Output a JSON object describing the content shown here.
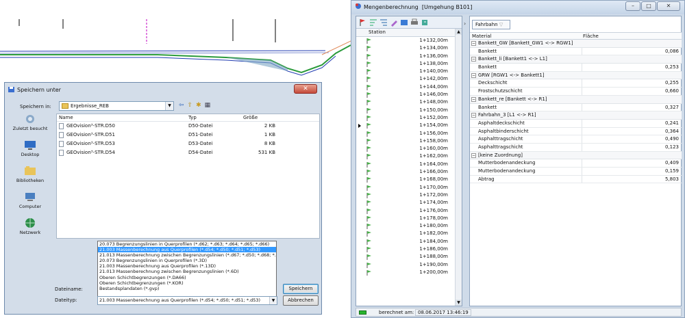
{
  "cad": {},
  "mengen_window": {
    "title": "Mengenberechnung",
    "subtitle": "[Umgehung B101]",
    "buttons": {
      "minimize": "–",
      "maximize": "□",
      "close": "✕"
    },
    "station_header": "Station",
    "stations": [
      "1+132,00m",
      "1+134,00m",
      "1+136,00m",
      "1+138,00m",
      "1+140,00m",
      "1+142,00m",
      "1+144,00m",
      "1+146,00m",
      "1+148,00m",
      "1+150,00m",
      "1+152,00m",
      "1+154,00m",
      "1+156,00m",
      "1+158,00m",
      "1+160,00m",
      "1+162,00m",
      "1+164,00m",
      "1+166,00m",
      "1+168,00m",
      "1+170,00m",
      "1+172,00m",
      "1+174,00m",
      "1+176,00m",
      "1+178,00m",
      "1+180,00m",
      "1+182,00m",
      "1+184,00m",
      "1+186,00m",
      "1+188,00m",
      "1+190,00m",
      "1+200,00m"
    ],
    "selected_station_index": 11,
    "filter_tab": "Fahrbahn",
    "col_material": "Material",
    "col_flaeche": "Fläche",
    "groups": [
      {
        "label": "Bankett_GW [Bankett_GW1 <-> RGW1]",
        "items": [
          {
            "name": "Bankett",
            "value": "0,086"
          }
        ]
      },
      {
        "label": "Bankett_li [Bankett1 <-> L1]",
        "items": [
          {
            "name": "Bankett",
            "value": "0,253"
          }
        ]
      },
      {
        "label": "GRW [RGW1 <-> Bankett1]",
        "items": [
          {
            "name": "Deckschicht",
            "value": "0,255"
          },
          {
            "name": "Frostschutzschicht",
            "value": "0,660"
          }
        ]
      },
      {
        "label": "Bankett_re [Bankett <-> R1]",
        "items": [
          {
            "name": "Bankett",
            "value": "0,327"
          }
        ]
      },
      {
        "label": "Fahrbahn_3 [L1 <-> R1]",
        "items": [
          {
            "name": "Asphaltdeckschicht",
            "value": "0,241"
          },
          {
            "name": "Asphaltbinderschicht",
            "value": "0,364"
          },
          {
            "name": "Asphalttragschicht",
            "value": "0,490"
          },
          {
            "name": "Asphalttragschicht",
            "value": "0,123"
          }
        ]
      },
      {
        "label": "[keine Zuordnung]",
        "items": [
          {
            "name": "Mutterbodenandeckung",
            "value": "0,409"
          },
          {
            "name": "Mutterbodenandeckung",
            "value": "0,159"
          },
          {
            "name": "Abtrag",
            "value": "5,803"
          }
        ]
      }
    ],
    "status_label": "berechnet am:",
    "status_value": "08.06.2017 13:46:19"
  },
  "dialog": {
    "title": "Speichern unter",
    "close": "✕",
    "save_in_label": "Speichern in:",
    "save_in_value": "Ergebnisse_REB",
    "places": [
      "Zuletzt besucht",
      "Desktop",
      "Bibliotheken",
      "Computer",
      "Netzwerk"
    ],
    "cols": {
      "name": "Name",
      "type": "Typ",
      "size": "Größe"
    },
    "files": [
      {
        "name": "GEOvision³-STR.D50",
        "type": "D50-Datei",
        "size": "2 KB"
      },
      {
        "name": "GEOvision³-STR.D51",
        "type": "D51-Datei",
        "size": "1 KB"
      },
      {
        "name": "GEOvision³-STR.D53",
        "type": "D53-Datei",
        "size": "8 KB"
      },
      {
        "name": "GEOvision³-STR.D54",
        "type": "D54-Datei",
        "size": "531 KB"
      }
    ],
    "filetypes": [
      "20.073 Begrenzungslinien in Querprofilen (*.d62; *.d63; *.d64; *.d65; *.d66)",
      "21.003 Massenberechnung aus Querprofilen (*.d54; *.d50; *.d51; *.d53)",
      "21.013 Massenberechnung zwischen Begrenzungslinien (*.d67; *.d50; *.d68; *.d66)",
      "20.073 Begrenzungslinien in Querprofilen (*.3D)",
      "21.003 Massenberechnung aus Querprofilen (*.13D)",
      "21.013 Massenberechnung zwischen Begrenzungslinien (*.6D)",
      "Oberen Schichtbegrenzungen (*.DA66)",
      "Oberen Schichtbegrenzungen (*.KOR)",
      "Bestandsplandaten  (*.gvp)"
    ],
    "selected_filetype_index": 1,
    "dateiname_label": "Dateiname:",
    "dateityp_label": "Dateityp:",
    "dateityp_value": "21.003 Massenberechnung aus Querprofilen (*.d54; *.d50; *.d51; *.d53)",
    "save_button": "Speichern",
    "cancel_button": "Abbrechen"
  }
}
